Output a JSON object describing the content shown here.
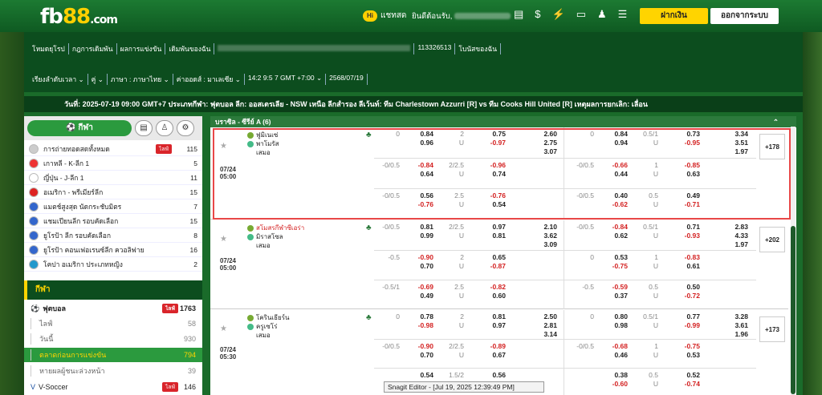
{
  "topbar": {
    "logo_main": "fb",
    "logo_num": "88",
    "logo_dom": ".com",
    "chat_badge": "Hi",
    "chat_label": "แชทสด",
    "welcome": "ยินดีต้อนรับ,",
    "deposit": "ฝากเงิน",
    "logout": "ออกจากระบบ",
    "icons": [
      "document-icon",
      "dollar-icon",
      "refresh-icon",
      "p2p-icon",
      "user-icon",
      "list-icon"
    ]
  },
  "header": {
    "row1": [
      "โหมดยุโรป",
      "กฎการเดิมพัน",
      "ผลการแข่งขัน",
      "เดิมพันของฉัน",
      "113326513",
      "โบนัสของฉัน"
    ],
    "row2": [
      "เรียงลำดับเวลา ⌄",
      "คู่ ⌄",
      "ภาษา : ภาษาไทย ⌄",
      "ค่าออดส์ : มาเลเซีย ⌄",
      "14:2 9:5 7 GMT +7:00 ⌄",
      "2568/07/19"
    ]
  },
  "notice": "วันที่: 2025-07-19 09:00 GMT+7 ประเภทกีฬา: ฟุตบอล ลีก: ออสเตรเลีย - NSW เหนือ ลีกสำรอง ลีเว้นท์: ทีม Charlestown Azzurri [R] vs ทีม Cooks Hill United [R] เหตุผลการยกเลิก: เลื่อน",
  "sidebar": {
    "tab_label": "กีฬา",
    "leagues": [
      {
        "label": "การถ่ายทอดสดทั้งหมด",
        "count": "115",
        "live": "ไลฟ์",
        "icon": "all"
      },
      {
        "label": "เกาหลี - K-ลีก 1",
        "count": "5",
        "icon": "kr"
      },
      {
        "label": "ญี่ปุ่น - J-ลีก 1",
        "count": "11",
        "icon": "jp"
      },
      {
        "label": "อเมริกา - พรีเมียร์ลีก",
        "count": "15",
        "icon": "us"
      },
      {
        "label": "แมตช์สูงสุด นัดกระชับมิตร",
        "count": "7",
        "icon": "cup"
      },
      {
        "label": "แชมเปียนลีก รอบคัดเลือก",
        "count": "15",
        "icon": "cup"
      },
      {
        "label": "ยูโรป้า ลีก รอบคัดเลือก",
        "count": "8",
        "icon": "cup"
      },
      {
        "label": "ยูโรป้า คอนเฟอเรนซ์ลีก ควอลิฟาย",
        "count": "16",
        "icon": "cup"
      },
      {
        "label": "โคปา อเมริกา ประเภทหญิง",
        "count": "2",
        "icon": "cp"
      }
    ],
    "sports_title": "กีฬา",
    "sports": [
      {
        "label": "ฟุตบอล",
        "count": "1763",
        "live": "ไลฟ์"
      },
      {
        "label": "ไลฟ์",
        "count": "58"
      },
      {
        "label": "วันนี้",
        "count": "930"
      },
      {
        "label": "ตลาดก่อนการแข่งขัน",
        "count": "794"
      },
      {
        "label": "หายผลผู้ชนะล่วงหน้า",
        "count": "39"
      },
      {
        "label": "V-Soccer",
        "count": "146",
        "live": "ไลฟ์"
      }
    ]
  },
  "league_header": "บราซิล - ซีรีย์ A (6)",
  "matches": [
    {
      "date": "07/24",
      "time": "05:00",
      "home": "ฟูมิเนเซ่",
      "away": "พาโมรัส",
      "draw": "เสมอ",
      "home_red": false,
      "more": "+178",
      "rows": [
        {
          "h1": "0",
          "a1": "",
          "o1": [
            "0.84",
            "0.96"
          ],
          "g1": [
            "2",
            "U"
          ],
          "p1": [
            "0.75",
            "-0.97"
          ],
          "x1": [
            "2.60",
            "2.75",
            "3.07"
          ],
          "h2": "0",
          "o2": [
            "0.84",
            "0.94"
          ],
          "g2": [
            "0.5/1",
            "U"
          ],
          "p2": [
            "0.73",
            "-0.95"
          ],
          "x2": [
            "3.34",
            "3.51",
            "1.97"
          ]
        },
        {
          "h1": "-0/0.5",
          "o1": [
            "-0.84",
            "0.64"
          ],
          "g1": [
            "2/2.5",
            "U"
          ],
          "p1": [
            "-0.96",
            "0.74"
          ],
          "h2": "-0/0.5",
          "o2": [
            "-0.66",
            "0.44"
          ],
          "g2": [
            "1",
            "U"
          ],
          "p2": [
            "-0.85",
            "0.63"
          ]
        },
        {
          "h1": "-0/0.5",
          "o1": [
            "0.56",
            "-0.76"
          ],
          "g1": [
            "2.5",
            "U"
          ],
          "p1": [
            "-0.76",
            "0.54"
          ],
          "h2": "-0/0.5",
          "o2": [
            "0.40",
            "-0.62"
          ],
          "g2": [
            "0.5",
            "U"
          ],
          "p2": [
            "0.49",
            "-0.71"
          ]
        }
      ]
    },
    {
      "date": "07/24",
      "time": "05:00",
      "home": "สโมสรกีฬาซีเอร่า",
      "away": "มิราสโซล",
      "draw": "เสมอ",
      "home_red": true,
      "more": "+202",
      "rows": [
        {
          "h1": "-0/0.5",
          "o1": [
            "0.81",
            "0.99"
          ],
          "g1": [
            "2/2.5",
            "U"
          ],
          "p1": [
            "0.97",
            "0.81"
          ],
          "x1": [
            "2.10",
            "3.62",
            "3.09"
          ],
          "h2": "-0/0.5",
          "o2": [
            "-0.84",
            "0.62"
          ],
          "g2": [
            "0.5/1",
            "U"
          ],
          "p2": [
            "0.71",
            "-0.93"
          ],
          "x2": [
            "2.83",
            "4.33",
            "1.97"
          ]
        },
        {
          "h1": "-0.5",
          "o1": [
            "-0.90",
            "0.70"
          ],
          "g1": [
            "2",
            "U"
          ],
          "p1": [
            "0.65",
            "-0.87"
          ],
          "h2": "0",
          "o2": [
            "0.53",
            "-0.75"
          ],
          "g2": [
            "1",
            "U"
          ],
          "p2": [
            "-0.83",
            "0.61"
          ]
        },
        {
          "h1": "-0.5/1",
          "o1": [
            "-0.69",
            "0.49"
          ],
          "g1": [
            "2.5",
            "U"
          ],
          "p1": [
            "-0.82",
            "0.60"
          ],
          "h2": "-0.5",
          "o2": [
            "-0.59",
            "0.37"
          ],
          "g2": [
            "0.5",
            "U"
          ],
          "p2": [
            "0.50",
            "-0.72"
          ]
        }
      ]
    },
    {
      "date": "07/24",
      "time": "05:30",
      "home": "โครินเธียร์น",
      "away": "ครูเซโร่",
      "draw": "เสมอ",
      "home_red": false,
      "more": "+173",
      "rows": [
        {
          "h1": "0",
          "o1": [
            "0.78",
            "-0.98"
          ],
          "g1": [
            "2",
            "U"
          ],
          "p1": [
            "0.81",
            "0.97"
          ],
          "x1": [
            "2.50",
            "2.81",
            "3.14"
          ],
          "h2": "0",
          "o2": [
            "0.80",
            "0.98"
          ],
          "g2": [
            "0.5/1",
            "U"
          ],
          "p2": [
            "0.77",
            "-0.99"
          ],
          "x2": [
            "3.28",
            "3.61",
            "1.96"
          ]
        },
        {
          "h1": "-0/0.5",
          "o1": [
            "-0.90",
            "0.70"
          ],
          "g1": [
            "2/2.5",
            "U"
          ],
          "p1": [
            "-0.89",
            "0.67"
          ],
          "h2": "-0/0.5",
          "o2": [
            "-0.68",
            "0.46"
          ],
          "g2": [
            "1",
            "U"
          ],
          "p2": [
            "-0.75",
            "0.53"
          ]
        },
        {
          "h1": "",
          "o1": [
            "0.54",
            ""
          ],
          "g1": [
            "1.5/2",
            ""
          ],
          "p1": [
            "0.56",
            ""
          ],
          "h2": "",
          "o2": [
            "0.38",
            "-0.60"
          ],
          "g2": [
            "0.5",
            "U"
          ],
          "p2": [
            "0.52",
            "-0.74"
          ]
        }
      ]
    }
  ],
  "tooltip": "Snagit Editor - [Jul 19, 2025 12:39:49 PM]"
}
